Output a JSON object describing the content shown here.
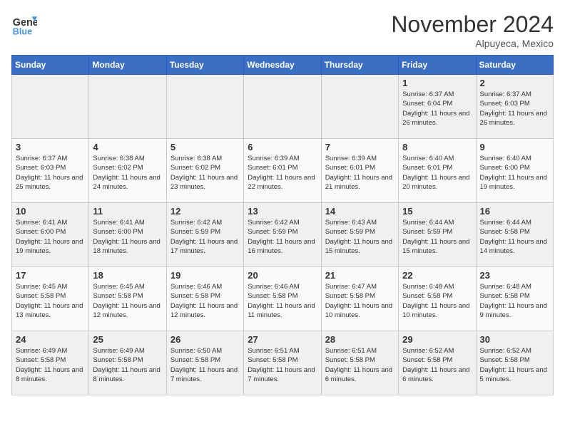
{
  "logo": {
    "line1": "General",
    "line2": "Blue"
  },
  "title": "November 2024",
  "location": "Alpuyeca, Mexico",
  "days_of_week": [
    "Sunday",
    "Monday",
    "Tuesday",
    "Wednesday",
    "Thursday",
    "Friday",
    "Saturday"
  ],
  "weeks": [
    [
      {
        "day": "",
        "info": ""
      },
      {
        "day": "",
        "info": ""
      },
      {
        "day": "",
        "info": ""
      },
      {
        "day": "",
        "info": ""
      },
      {
        "day": "",
        "info": ""
      },
      {
        "day": "1",
        "info": "Sunrise: 6:37 AM\nSunset: 6:04 PM\nDaylight: 11 hours and 26 minutes."
      },
      {
        "day": "2",
        "info": "Sunrise: 6:37 AM\nSunset: 6:03 PM\nDaylight: 11 hours and 26 minutes."
      }
    ],
    [
      {
        "day": "3",
        "info": "Sunrise: 6:37 AM\nSunset: 6:03 PM\nDaylight: 11 hours and 25 minutes."
      },
      {
        "day": "4",
        "info": "Sunrise: 6:38 AM\nSunset: 6:02 PM\nDaylight: 11 hours and 24 minutes."
      },
      {
        "day": "5",
        "info": "Sunrise: 6:38 AM\nSunset: 6:02 PM\nDaylight: 11 hours and 23 minutes."
      },
      {
        "day": "6",
        "info": "Sunrise: 6:39 AM\nSunset: 6:01 PM\nDaylight: 11 hours and 22 minutes."
      },
      {
        "day": "7",
        "info": "Sunrise: 6:39 AM\nSunset: 6:01 PM\nDaylight: 11 hours and 21 minutes."
      },
      {
        "day": "8",
        "info": "Sunrise: 6:40 AM\nSunset: 6:01 PM\nDaylight: 11 hours and 20 minutes."
      },
      {
        "day": "9",
        "info": "Sunrise: 6:40 AM\nSunset: 6:00 PM\nDaylight: 11 hours and 19 minutes."
      }
    ],
    [
      {
        "day": "10",
        "info": "Sunrise: 6:41 AM\nSunset: 6:00 PM\nDaylight: 11 hours and 19 minutes."
      },
      {
        "day": "11",
        "info": "Sunrise: 6:41 AM\nSunset: 6:00 PM\nDaylight: 11 hours and 18 minutes."
      },
      {
        "day": "12",
        "info": "Sunrise: 6:42 AM\nSunset: 5:59 PM\nDaylight: 11 hours and 17 minutes."
      },
      {
        "day": "13",
        "info": "Sunrise: 6:42 AM\nSunset: 5:59 PM\nDaylight: 11 hours and 16 minutes."
      },
      {
        "day": "14",
        "info": "Sunrise: 6:43 AM\nSunset: 5:59 PM\nDaylight: 11 hours and 15 minutes."
      },
      {
        "day": "15",
        "info": "Sunrise: 6:44 AM\nSunset: 5:59 PM\nDaylight: 11 hours and 15 minutes."
      },
      {
        "day": "16",
        "info": "Sunrise: 6:44 AM\nSunset: 5:58 PM\nDaylight: 11 hours and 14 minutes."
      }
    ],
    [
      {
        "day": "17",
        "info": "Sunrise: 6:45 AM\nSunset: 5:58 PM\nDaylight: 11 hours and 13 minutes."
      },
      {
        "day": "18",
        "info": "Sunrise: 6:45 AM\nSunset: 5:58 PM\nDaylight: 11 hours and 12 minutes."
      },
      {
        "day": "19",
        "info": "Sunrise: 6:46 AM\nSunset: 5:58 PM\nDaylight: 11 hours and 12 minutes."
      },
      {
        "day": "20",
        "info": "Sunrise: 6:46 AM\nSunset: 5:58 PM\nDaylight: 11 hours and 11 minutes."
      },
      {
        "day": "21",
        "info": "Sunrise: 6:47 AM\nSunset: 5:58 PM\nDaylight: 11 hours and 10 minutes."
      },
      {
        "day": "22",
        "info": "Sunrise: 6:48 AM\nSunset: 5:58 PM\nDaylight: 11 hours and 10 minutes."
      },
      {
        "day": "23",
        "info": "Sunrise: 6:48 AM\nSunset: 5:58 PM\nDaylight: 11 hours and 9 minutes."
      }
    ],
    [
      {
        "day": "24",
        "info": "Sunrise: 6:49 AM\nSunset: 5:58 PM\nDaylight: 11 hours and 8 minutes."
      },
      {
        "day": "25",
        "info": "Sunrise: 6:49 AM\nSunset: 5:58 PM\nDaylight: 11 hours and 8 minutes."
      },
      {
        "day": "26",
        "info": "Sunrise: 6:50 AM\nSunset: 5:58 PM\nDaylight: 11 hours and 7 minutes."
      },
      {
        "day": "27",
        "info": "Sunrise: 6:51 AM\nSunset: 5:58 PM\nDaylight: 11 hours and 7 minutes."
      },
      {
        "day": "28",
        "info": "Sunrise: 6:51 AM\nSunset: 5:58 PM\nDaylight: 11 hours and 6 minutes."
      },
      {
        "day": "29",
        "info": "Sunrise: 6:52 AM\nSunset: 5:58 PM\nDaylight: 11 hours and 6 minutes."
      },
      {
        "day": "30",
        "info": "Sunrise: 6:52 AM\nSunset: 5:58 PM\nDaylight: 11 hours and 5 minutes."
      }
    ]
  ]
}
